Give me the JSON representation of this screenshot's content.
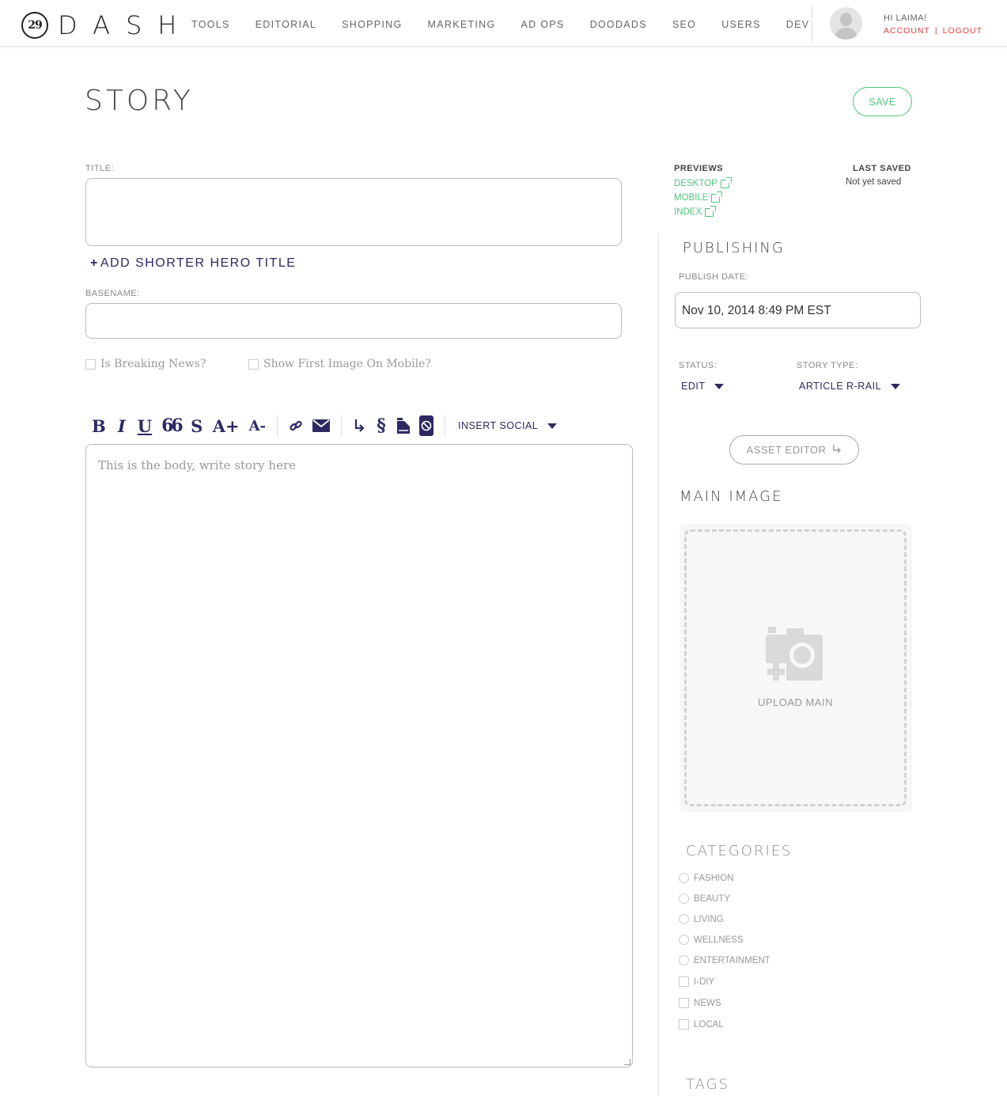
{
  "header": {
    "logo_mark": "29",
    "logo_text": "DASH",
    "nav": [
      "TOOLS",
      "EDITORIAL",
      "SHOPPING",
      "MARKETING",
      "AD OPS",
      "DOODADS",
      "SEO",
      "USERS",
      "DEV"
    ],
    "greeting": "HI LAIMA!",
    "account": "ACCOUNT",
    "separator": "|",
    "logout": "LOGOUT"
  },
  "page": {
    "title": "STORY",
    "save_label": "SAVE"
  },
  "form": {
    "title_label": "TITLE:",
    "title_value": "",
    "hero_link": "ADD SHORTER HERO TITLE",
    "hero_plus": "+",
    "basename_label": "BASENAME:",
    "basename_value": "",
    "breaking_news_label": "Is Breaking News?",
    "first_image_label": "Show First Image On Mobile?",
    "body_placeholder": "This is the body, write story here"
  },
  "toolbar": {
    "bold": "B",
    "italic": "I",
    "underline": "U",
    "quote": "66",
    "strike": "S",
    "font_up": "A+",
    "font_down": "A-",
    "insert_social": "INSERT SOCIAL"
  },
  "sidebar": {
    "previews_heading": "PREVIEWS",
    "previews": [
      "DESKTOP",
      "MOBILE",
      "INDEX"
    ],
    "last_saved_heading": "LAST SAVED",
    "last_saved_value": "Not yet saved",
    "publishing_heading": "PUBLISHING",
    "publish_date_label": "PUBLISH DATE:",
    "publish_date_value": "Nov 10, 2014 8:49 PM EST",
    "status_label": "STATUS:",
    "status_value": "EDIT",
    "story_type_label": "STORY TYPE:",
    "story_type_value": "ARTICLE R-RAIL",
    "asset_editor": "ASSET EDITOR",
    "main_image_heading": "MAIN IMAGE",
    "upload_label": "UPLOAD MAIN",
    "categories_heading": "CATEGORIES",
    "categories_radio": [
      "FASHION",
      "BEAUTY",
      "LIVING",
      "WELLNESS",
      "ENTERTAINMENT"
    ],
    "categories_check": [
      "I-DIY",
      "NEWS",
      "LOCAL"
    ],
    "tags_heading": "TAGS"
  },
  "colors": {
    "accent_navy": "#2d2a63",
    "green": "#4cc77a",
    "red": "#e23b3b"
  }
}
